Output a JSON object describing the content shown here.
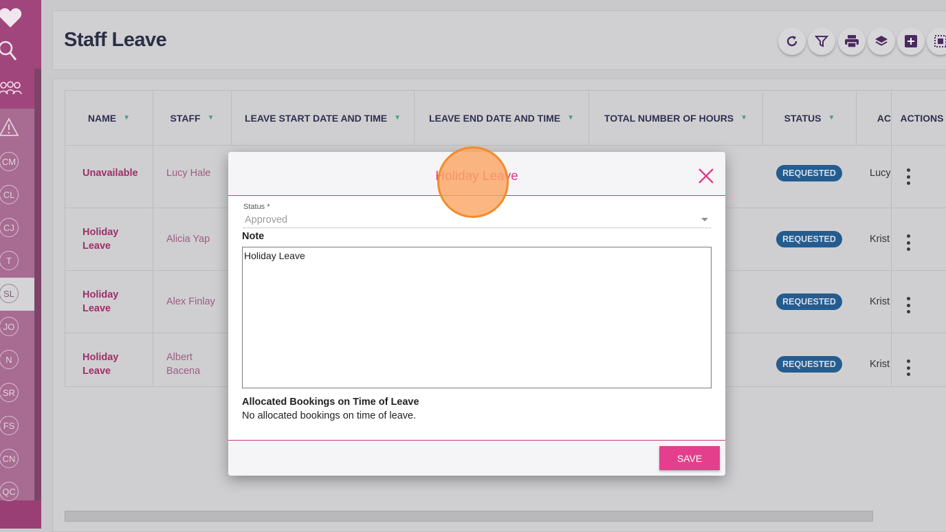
{
  "sidebar": {
    "top_icons": [
      "heart-icon",
      "search-icon",
      "people-icon"
    ],
    "warning_icon": "warning-icon",
    "items": [
      {
        "label": "CM"
      },
      {
        "label": "CL"
      },
      {
        "label": "CJ"
      },
      {
        "label": "T"
      },
      {
        "label": "SL",
        "active": true
      },
      {
        "label": "JO"
      },
      {
        "label": "N"
      },
      {
        "label": "SR"
      },
      {
        "label": "FS"
      },
      {
        "label": "CN"
      },
      {
        "label": "QC"
      }
    ]
  },
  "header": {
    "title": "Staff Leave",
    "toolbar_icons": [
      "refresh-icon",
      "filter-icon",
      "print-icon",
      "layers-icon",
      "add-icon",
      "select-all-icon"
    ]
  },
  "table": {
    "columns": [
      {
        "label": "NAME"
      },
      {
        "label": "STAFF"
      },
      {
        "label": "LEAVE START DATE AND TIME"
      },
      {
        "label": "LEAVE END DATE AND TIME"
      },
      {
        "label": "TOTAL NUMBER OF HOURS"
      },
      {
        "label": "STATUS"
      },
      {
        "label": "AC"
      },
      {
        "label": "ACTIONS"
      }
    ],
    "rows": [
      {
        "name": "Unavailable",
        "staff": "Lucy Hale",
        "status": "REQUESTED",
        "actioned_by": "Lucy"
      },
      {
        "name": "Holiday Leave",
        "staff": "Alicia Yap",
        "status": "REQUESTED",
        "actioned_by": "Krist"
      },
      {
        "name": "Holiday Leave",
        "staff": "Alex Finlay",
        "status": "REQUESTED",
        "actioned_by": "Krist"
      },
      {
        "name": "Holiday Leave",
        "staff": "Albert Bacena",
        "status": "REQUESTED",
        "actioned_by": "Krist"
      }
    ]
  },
  "modal": {
    "title": "Holiday Leave",
    "status_label": "Status *",
    "status_value": "Approved",
    "note_label": "Note",
    "note_value": "Holiday Leave",
    "allocated_title": "Allocated Bookings on Time of Leave",
    "allocated_text": "No allocated bookings on time of leave.",
    "save_label": "SAVE"
  },
  "colors": {
    "sidebar": "#a0467c",
    "accent_pink": "#e43f8c",
    "status_badge": "#245c8f",
    "click_marker": "#fba665"
  }
}
